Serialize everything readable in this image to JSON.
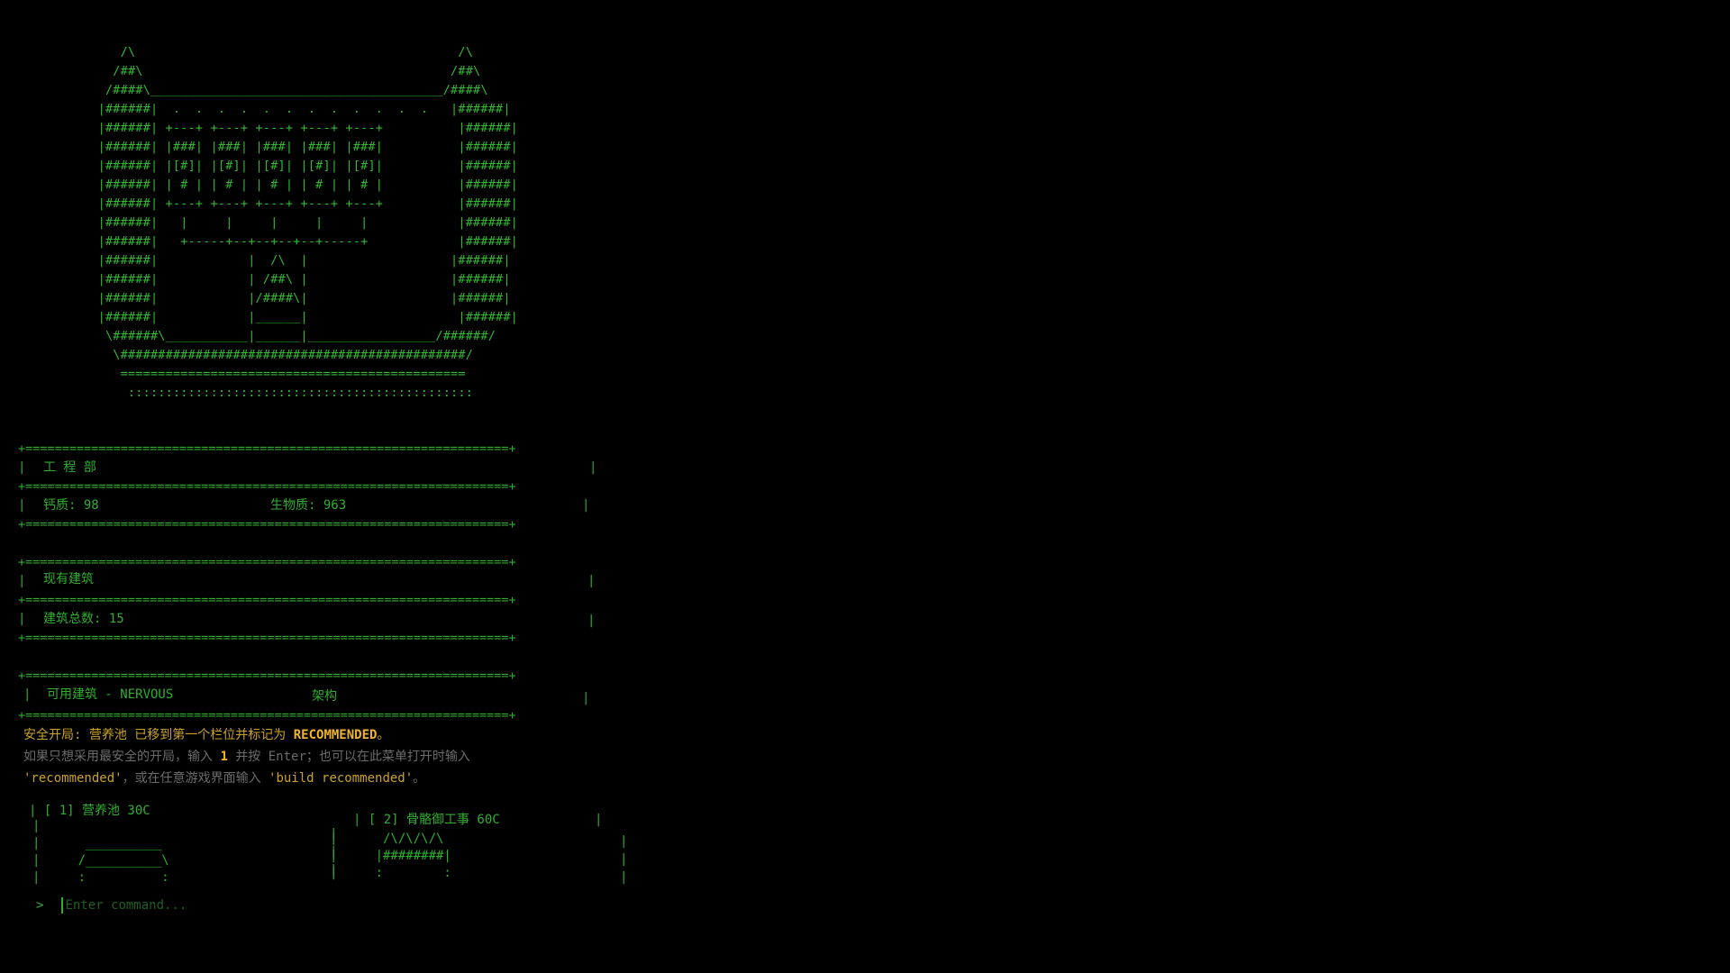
{
  "castle_art": [
    "     /\\                                           /\\",
    "    /##\\                                         /##\\",
    "   /####\\_______________________________________/####\\",
    "  |######|  .  .  .  .  .  .  .  .  .  .  .  .   |######|",
    "  |######| +---+ +---+ +---+ +---+ +---+          |######|",
    "  |######| |###| |###| |###| |###| |###|          |######|",
    "  |######| |[#]| |[#]| |[#]| |[#]| |[#]|          |######|",
    "  |######| | # | | # | | # | | # | | # |          |######|",
    "  |######| +---+ +---+ +---+ +---+ +---+          |######|",
    "  |######|   |     |     |     |     |            |######|",
    "  |######|   +-----+--+--+--+--+-----+            |######|",
    "  |######|            |  /\\  |                   |######|",
    "  |######|            | /##\\ |                   |######|",
    "  |######|            |/####\\|                   |######|",
    "  |######|            |______|                    |######|",
    "   \\######\\___________|______|_________________/######/",
    "    \\##############################################/",
    "     ==============================================",
    "      ::::::::::::::::::::::::::::::::::::::::::::::"
  ],
  "engineering": {
    "border": "+==================================================================+",
    "title": "工 程 部",
    "calcium_label": "钙质: 98",
    "biomass_label": "生物质: 963"
  },
  "existing": {
    "title": "现有建筑",
    "total_label": "建筑总数: 15"
  },
  "available": {
    "title": "可用建筑 - NERVOUS",
    "subtitle": "架构"
  },
  "notice": {
    "safe_label": "安全开局:",
    "safe_text": " 营养池 已移到第一个栏位并标记为 ",
    "recommended": "RECOMMENDED",
    "period": "。",
    "line2_pre": "如果只想采用最安全的开局，输入 ",
    "line2_key": "1",
    "line2_post": " 并按 Enter；也可以在此菜单打开时输入",
    "line3_cmd1": "'recommended'",
    "line3_mid": "，或在任意游戏界面输入 ",
    "line3_cmd2": "'build recommended'",
    "line3_end": "。"
  },
  "cards": [
    {
      "header": "| [ 1] 营养池 30C",
      "art": "|\n|      __________\n|     /__________\\\n|     :          :"
    },
    {
      "header": "| [ 2] 骨骼御工事 60C",
      "art": "|      /\\/\\/\\/\\\n|     |########|\n|     :        :"
    }
  ],
  "prompt": {
    "symbol": ">",
    "placeholder": "Enter command..."
  }
}
